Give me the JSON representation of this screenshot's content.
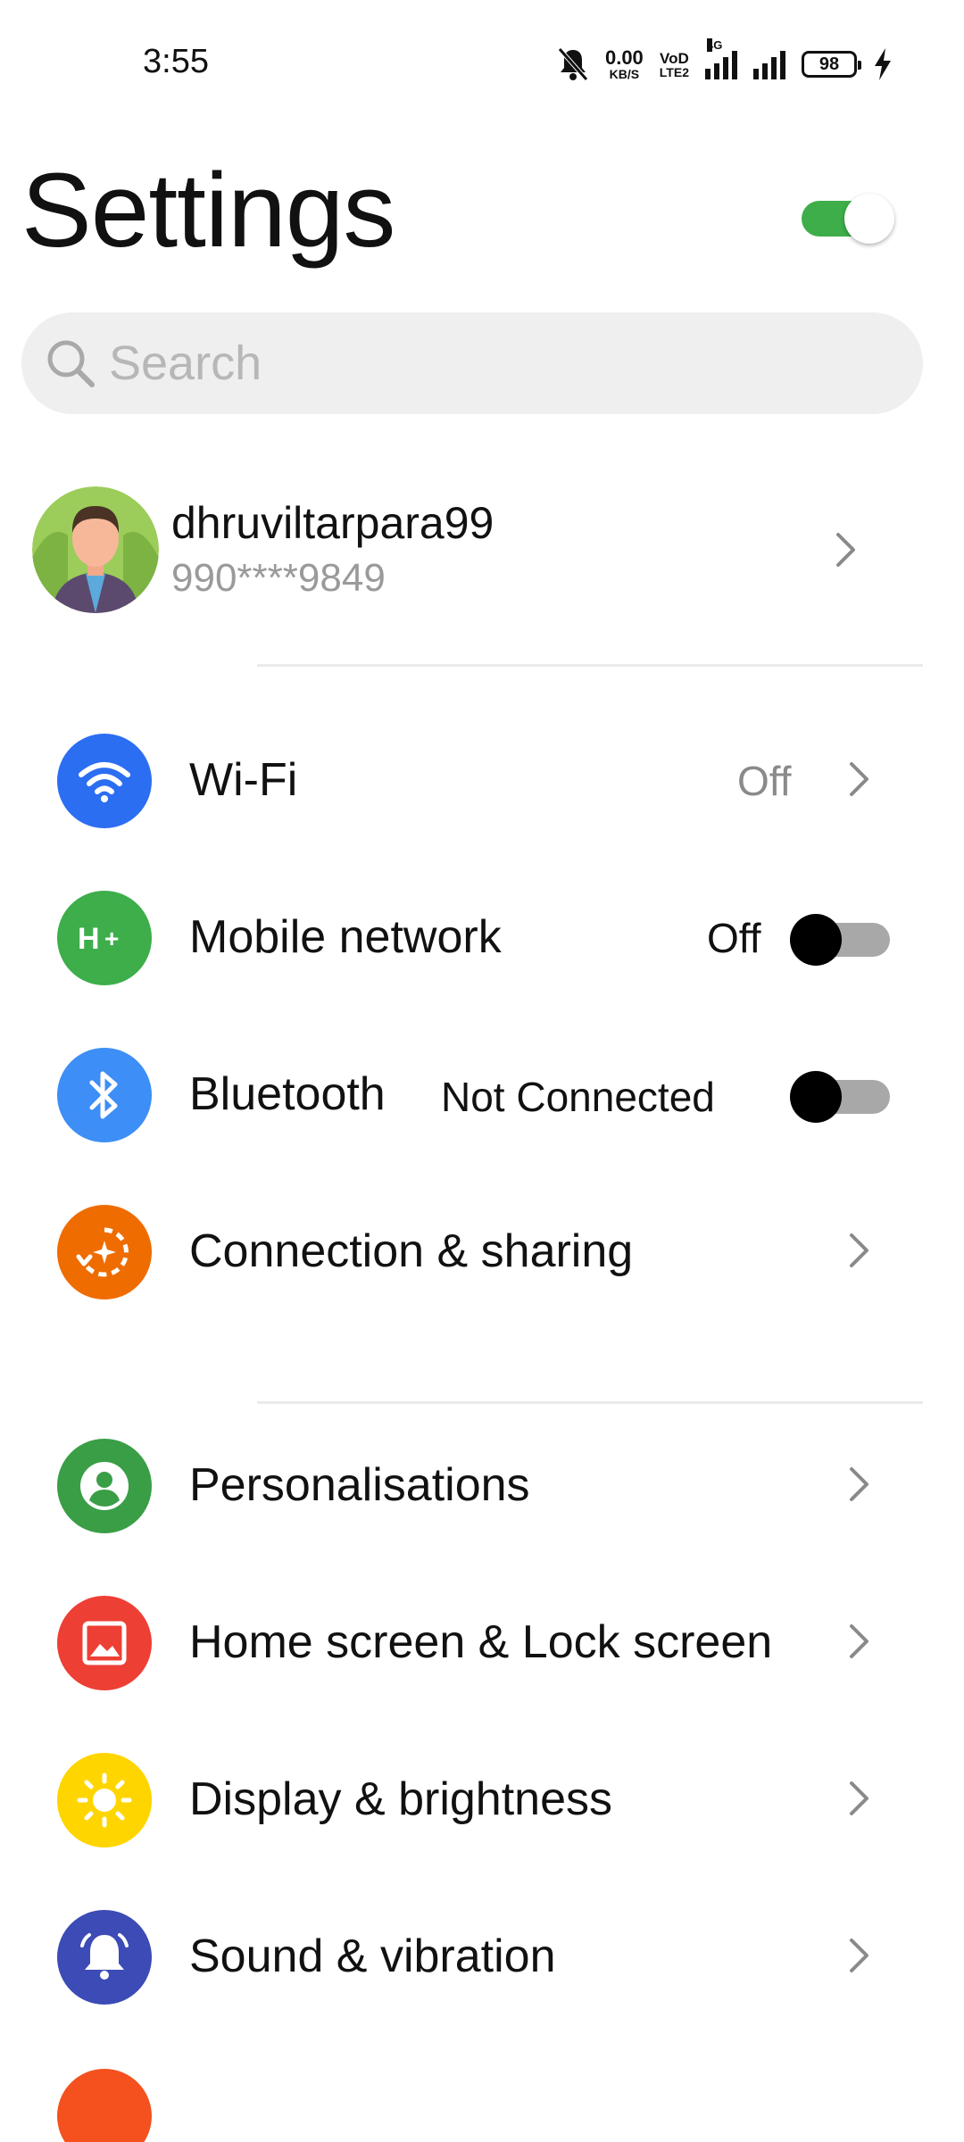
{
  "status_bar": {
    "time": "3:55",
    "net_speed_value": "0.00",
    "net_speed_unit": "KB/S",
    "volte_top": "VoD",
    "volte_bottom": "LTE2",
    "network_type": "4G",
    "battery": "98",
    "icons": [
      "mute-bell-icon",
      "signal-icon",
      "signal-icon",
      "battery-icon",
      "charging-bolt-icon"
    ]
  },
  "header": {
    "title": "Settings",
    "toggle_on": true
  },
  "search": {
    "placeholder": "Search",
    "value": ""
  },
  "profile": {
    "username": "dhruviltarpara99",
    "phone": "990****9849"
  },
  "items": [
    {
      "label": "Wi-Fi",
      "value": "Off",
      "control": "chevron",
      "icon": "wifi-icon",
      "color": "#2c6ef2"
    },
    {
      "label": "Mobile network",
      "value": "Off",
      "control": "toggle",
      "toggle_on": false,
      "icon": "mobile-data-icon",
      "color": "#3dae4a"
    },
    {
      "label": "Bluetooth",
      "value": "Not Connected",
      "control": "toggle",
      "toggle_on": false,
      "icon": "bluetooth-icon",
      "color": "#3d8ef6"
    },
    {
      "label": "Connection & sharing",
      "value": "",
      "control": "chevron",
      "icon": "connection-sharing-icon",
      "color": "#ef6c00"
    },
    {
      "label": "Personalisations",
      "value": "",
      "control": "chevron",
      "icon": "personalisation-icon",
      "color": "#3a9e46"
    },
    {
      "label": "Home screen & Lock screen",
      "value": "",
      "control": "chevron",
      "icon": "home-lock-screen-icon",
      "color": "#ee3f35"
    },
    {
      "label": "Display & brightness",
      "value": "",
      "control": "chevron",
      "icon": "brightness-icon",
      "color": "#ffd500"
    },
    {
      "label": "Sound & vibration",
      "value": "",
      "control": "chevron",
      "icon": "bell-icon",
      "color": "#3c4bb5"
    }
  ],
  "colors": {
    "toggle_on": "#3dae4a",
    "toggle_off_track": "#a8a8a8",
    "secondary_text": "#9a9a9a",
    "search_bg": "#efefef"
  }
}
